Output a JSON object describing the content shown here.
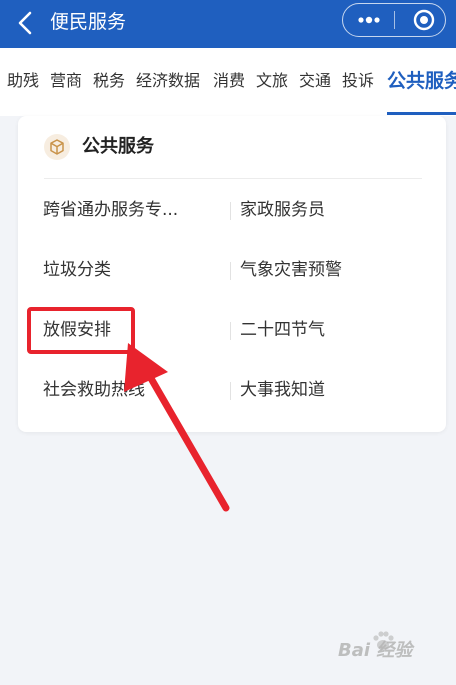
{
  "header": {
    "title": "便民服务"
  },
  "tabs": [
    "助残",
    "营商",
    "税务",
    "经济数据",
    "消费",
    "文旅",
    "交通",
    "投诉",
    "公共服务"
  ],
  "active_tab_index": 8,
  "card": {
    "title": "公共服务",
    "items_left": [
      "跨省通办服务专...",
      "垃圾分类",
      "放假安排",
      "社会救助热线"
    ],
    "items_right": [
      "家政服务员",
      "气象灾害预警",
      "二十四节气",
      "大事我知道"
    ]
  },
  "watermark": "Bai 经验",
  "colors": {
    "brand_blue": "#1f5fbf",
    "annotation_red": "#e8232d",
    "page_bg": "#f2f4f8"
  }
}
